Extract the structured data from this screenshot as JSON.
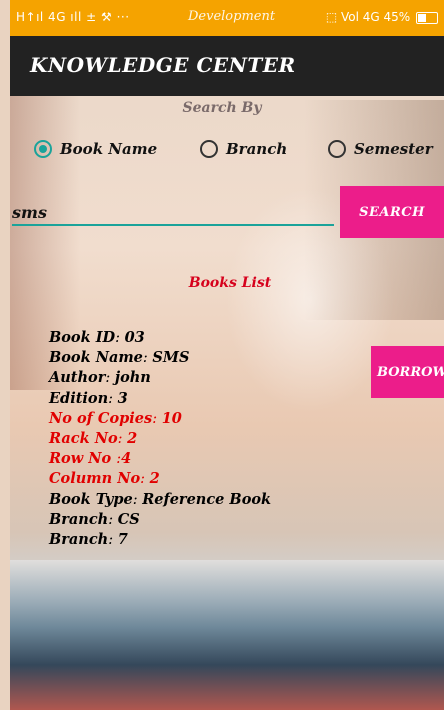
{
  "status_bar": {
    "left": "H↑ıl 4G ıll ± ⚒ ···",
    "mid": "Development",
    "right": "⬚ Vol 4G 45%"
  },
  "app_bar": {
    "title": "KNOWLEDGE CENTER"
  },
  "search_by": {
    "label": "Search By",
    "options": [
      {
        "label": "Book Name",
        "checked": true
      },
      {
        "label": "Branch",
        "checked": false
      },
      {
        "label": "Semester",
        "checked": false
      }
    ]
  },
  "search": {
    "value": "sms",
    "button_label": "SEARCH"
  },
  "books_list": {
    "title": "Books List"
  },
  "book": {
    "borrow_label": "BORROW",
    "fields": [
      {
        "key": "Book ID",
        "sep": ": ",
        "value": "03",
        "red": false
      },
      {
        "key": "Book Name",
        "sep": ": ",
        "value": "SMS",
        "red": false
      },
      {
        "key": "Author",
        "sep": ": ",
        "value": "john",
        "red": false
      },
      {
        "key": "Edition",
        "sep": ": ",
        "value": "3",
        "red": false
      },
      {
        "key": "No of Copies",
        "sep": ": ",
        "value": "10",
        "red": true
      },
      {
        "key": "Rack No",
        "sep": ": ",
        "value": "2",
        "red": true
      },
      {
        "key": "Row No ",
        "sep": ":",
        "value": "4",
        "red": true
      },
      {
        "key": "Column No",
        "sep": ": ",
        "value": "2",
        "red": true
      },
      {
        "key": "Book Type",
        "sep": ": ",
        "value": "Reference Book",
        "red": false
      },
      {
        "key": "Branch",
        "sep": ": ",
        "value": "CS",
        "red": false
      },
      {
        "key": "Branch",
        "sep": ": ",
        "value": "7",
        "red": false
      }
    ]
  },
  "colors": {
    "accent": "#1aa39a",
    "button": "#ec1d8a",
    "status": "#f5a300",
    "appbar": "#222222",
    "highlight": "#e10000"
  }
}
